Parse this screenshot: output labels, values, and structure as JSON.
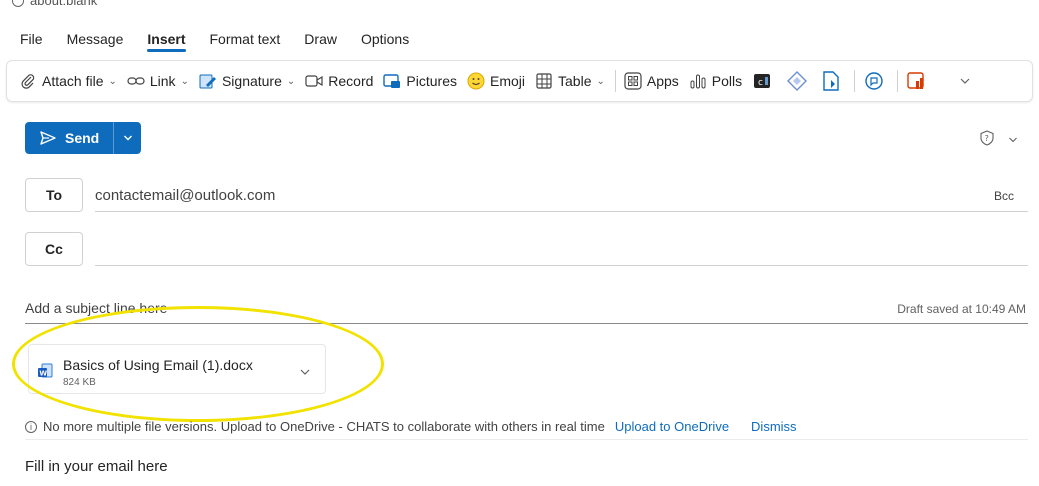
{
  "browser": {
    "url_text": "about:blank"
  },
  "menu": {
    "items": [
      "File",
      "Message",
      "Insert",
      "Format text",
      "Draw",
      "Options"
    ],
    "active": "Insert"
  },
  "toolbar": {
    "attach_file": "Attach file",
    "link": "Link",
    "signature": "Signature",
    "record": "Record",
    "pictures": "Pictures",
    "emoji": "Emoji",
    "table": "Table",
    "apps": "Apps",
    "polls": "Polls"
  },
  "compose": {
    "send_label": "Send",
    "to_label": "To",
    "to_value": "contactemail@outlook.com",
    "bcc_label": "Bcc",
    "cc_label": "Cc",
    "cc_value": "",
    "subject_placeholder": "Add a subject line here",
    "draft_status": "Draft saved at 10:49 AM",
    "attachment": {
      "name": "Basics of Using Email (1).docx",
      "size": "824 KB"
    },
    "info_message": "No more multiple file versions. Upload to OneDrive - CHATS to collaborate with others in real time",
    "upload_link": "Upload to OneDrive",
    "dismiss_link": "Dismiss",
    "body_text": "Fill in your email here"
  },
  "colors": {
    "accent": "#0f6cbd",
    "highlight": "#f2e200"
  }
}
